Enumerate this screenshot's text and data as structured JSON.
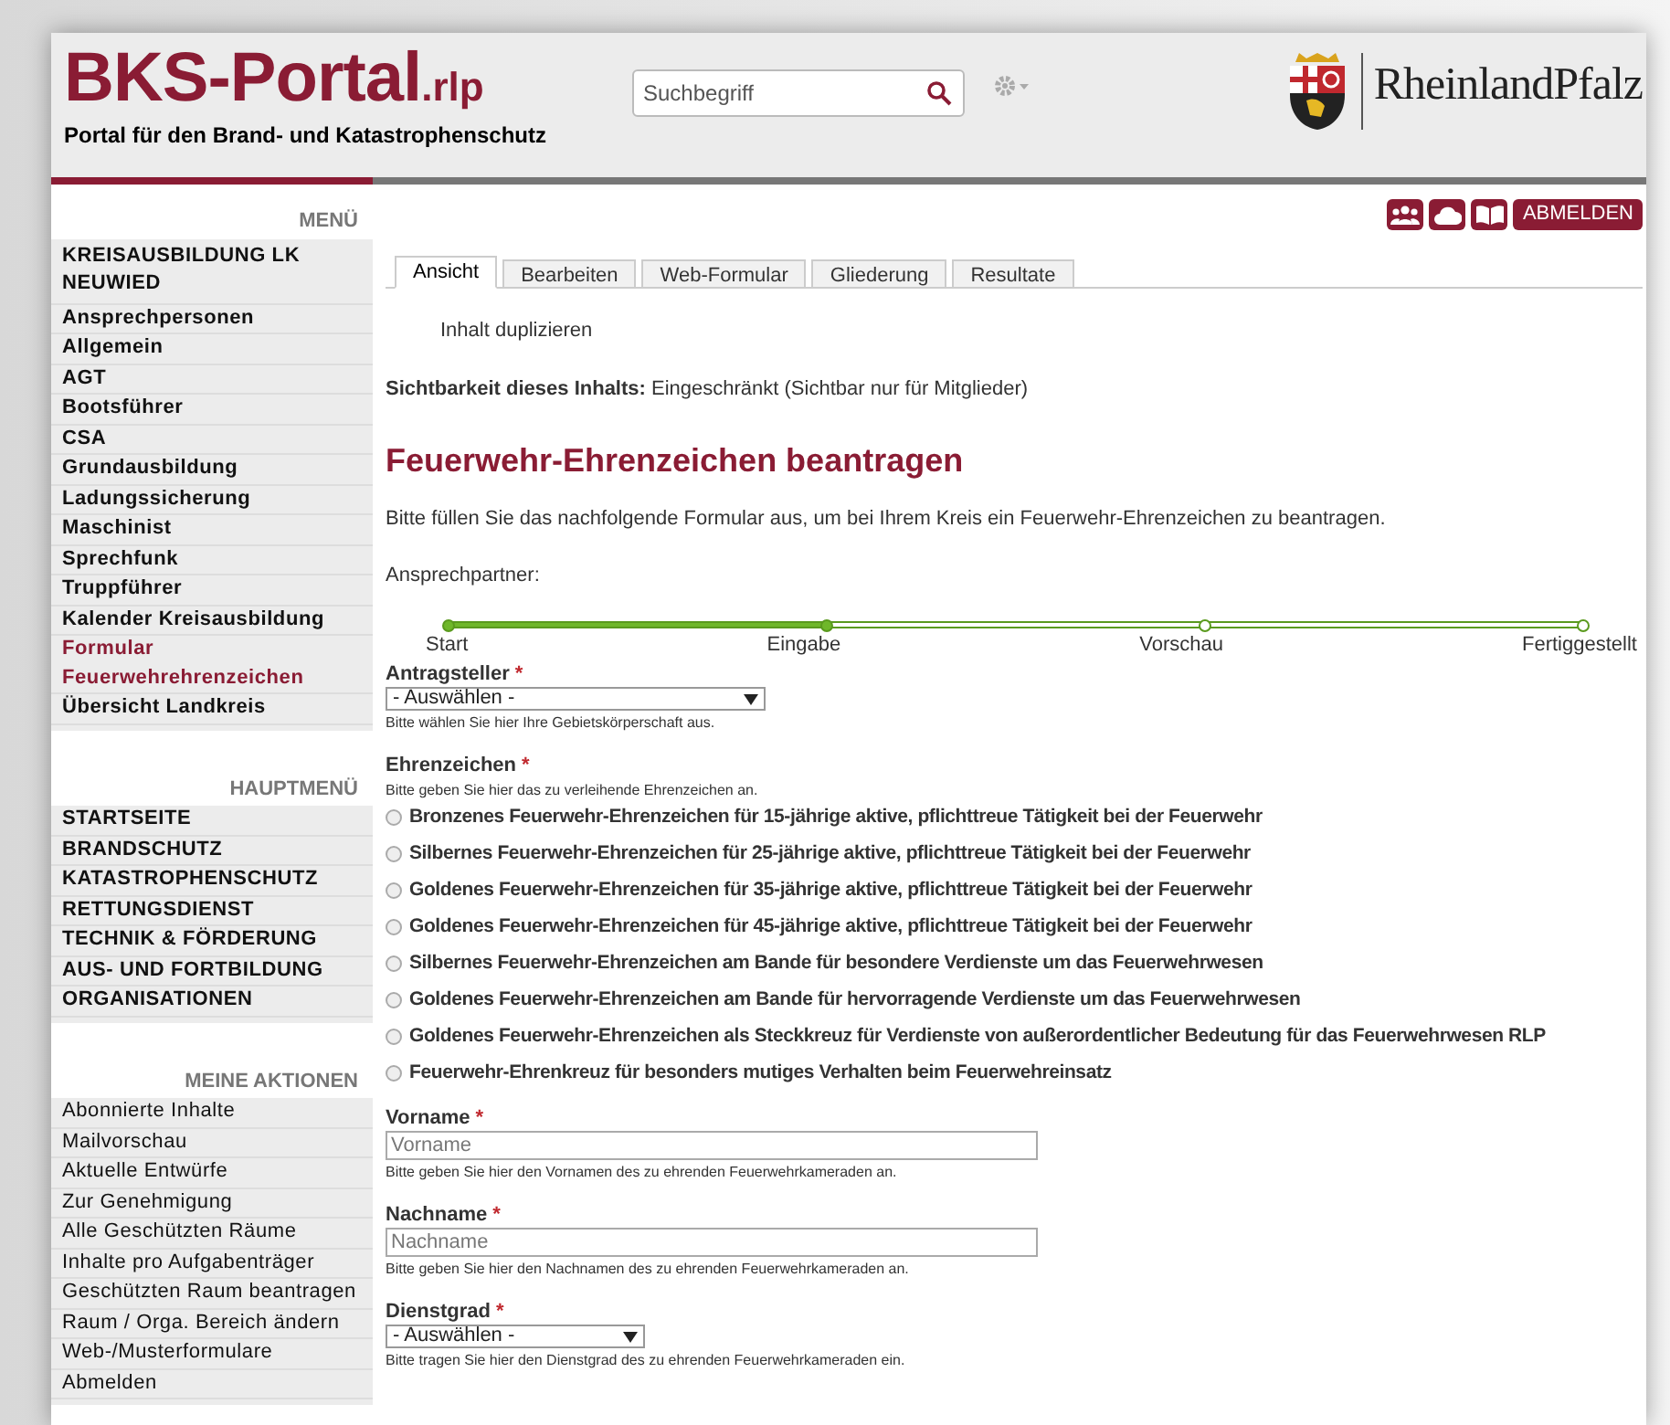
{
  "header": {
    "logo_main": "BKS-Portal",
    "logo_suffix": ".rlp",
    "subtitle": "Portal für den Brand- und Katastrophenschutz",
    "search": {
      "placeholder": "Suchbegriff"
    },
    "state_logo": "RheinlandPfalz"
  },
  "sidebar": [
    {
      "title": "MENÜ",
      "kind": "bold",
      "items": [
        {
          "label": "KREISAUSBILDUNG LK NEUWIED",
          "selected": false
        },
        {
          "label": "Ansprechpersonen",
          "selected": false
        },
        {
          "label": "Allgemein",
          "selected": false
        },
        {
          "label": "AGT",
          "selected": false
        },
        {
          "label": "Bootsführer",
          "selected": false
        },
        {
          "label": "CSA",
          "selected": false
        },
        {
          "label": "Grundausbildung",
          "selected": false
        },
        {
          "label": "Ladungssicherung",
          "selected": false
        },
        {
          "label": "Maschinist",
          "selected": false
        },
        {
          "label": "Sprechfunk",
          "selected": false
        },
        {
          "label": "Truppführer",
          "selected": false
        },
        {
          "label": "Kalender Kreisausbildung",
          "selected": false
        },
        {
          "label": "Formular Feuerwehrehrenzeichen",
          "selected": true
        },
        {
          "label": "Übersicht Landkreis",
          "selected": false
        }
      ]
    },
    {
      "title": "HAUPTMENÜ",
      "kind": "bold",
      "items": [
        {
          "label": "STARTSEITE",
          "selected": false
        },
        {
          "label": "BRANDSCHUTZ",
          "selected": false
        },
        {
          "label": "KATASTROPHENSCHUTZ",
          "selected": false
        },
        {
          "label": "RETTUNGSDIENST",
          "selected": false
        },
        {
          "label": "TECHNIK & FÖRDERUNG",
          "selected": false
        },
        {
          "label": "AUS- UND FORTBILDUNG",
          "selected": false
        },
        {
          "label": "ORGANISATIONEN",
          "selected": false
        }
      ]
    },
    {
      "title": "MEINE AKTIONEN",
      "kind": "plain",
      "items": [
        {
          "label": "Abonnierte Inhalte",
          "selected": false
        },
        {
          "label": "Mailvorschau",
          "selected": false
        },
        {
          "label": "Aktuelle Entwürfe",
          "selected": false
        },
        {
          "label": "Zur Genehmigung",
          "selected": false
        },
        {
          "label": "Alle Geschützten Räume",
          "selected": false
        },
        {
          "label": "Inhalte pro Aufgabenträger",
          "selected": false
        },
        {
          "label": "Geschützten Raum beantragen",
          "selected": false
        },
        {
          "label": "Raum / Orga. Bereich ändern",
          "selected": false
        },
        {
          "label": "Web-/Musterformulare",
          "selected": false
        },
        {
          "label": "Abmelden",
          "selected": false
        }
      ]
    }
  ],
  "logout_button": "ABMELDEN",
  "tabs": [
    {
      "label": "Ansicht",
      "selected": true
    },
    {
      "label": "Bearbeiten",
      "selected": false
    },
    {
      "label": "Web-Formular",
      "selected": false
    },
    {
      "label": "Gliederung",
      "selected": false
    },
    {
      "label": "Resultate",
      "selected": false
    }
  ],
  "duplicate_link": "Inhalt duplizieren",
  "visibility": "**Sichtbarkeit dieses Inhalts:** Eingeschränkt (Sichtbar nur für Mitglieder)",
  "title": "Feuerwehr-Ehrenzeichen beantragen",
  "intro": "Bitte füllen Sie das nachfolgende Formular aus, um bei Ihrem Kreis ein Feuerwehr-Ehrenzeichen zu beantragen.",
  "contact_label": "Ansprechpartner:",
  "progress": [
    {
      "label": "Start",
      "done": true
    },
    {
      "label": "Eingabe",
      "done": true
    },
    {
      "label": "Vorschau",
      "done": false
    },
    {
      "label": "Fertiggestellt",
      "done": false
    }
  ],
  "fields": [
    {
      "kind": "select",
      "label": "Antragsteller",
      "required_mark": "*",
      "value": "- Auswählen -",
      "help": "Bitte wählen Sie hier Ihre Gebietskörperschaft aus.",
      "wide": true
    },
    {
      "kind": "radio",
      "label": "Ehrenzeichen",
      "required_mark": "*",
      "help": "Bitte geben Sie hier das zu verleihende Ehrenzeichen an.",
      "options": [
        {
          "label": "Bronzenes Feuerwehr-Ehrenzeichen für 15-jährige aktive, pflichttreue Tätigkeit bei der Feuerwehr",
          "selected": false
        },
        {
          "label": "Silbernes Feuerwehr-Ehrenzeichen für 25-jährige aktive, pflichttreue Tätigkeit bei der Feuerwehr",
          "selected": false
        },
        {
          "label": "Goldenes Feuerwehr-Ehrenzeichen für 35-jährige aktive, pflichttreue Tätigkeit bei der Feuerwehr",
          "selected": false
        },
        {
          "label": "Goldenes Feuerwehr-Ehrenzeichen für 45-jährige aktive, pflichttreue Tätigkeit bei der Feuerwehr",
          "selected": false
        },
        {
          "label": "Silbernes Feuerwehr-Ehrenzeichen am Bande für besondere Verdienste um das Feuerwehrwesen",
          "selected": false
        },
        {
          "label": "Goldenes Feuerwehr-Ehrenzeichen am Bande für hervorragende Verdienste um das Feuerwehrwesen",
          "selected": false
        },
        {
          "label": "Goldenes Feuerwehr-Ehrenzeichen als Steckkreuz für Verdienste von außerordentlicher Bedeutung für das Feuerwehrwesen RLP",
          "selected": false
        },
        {
          "label": "Feuerwehr-Ehrenkreuz für besonders mutiges Verhalten beim Feuerwehreinsatz",
          "selected": false
        }
      ]
    },
    {
      "kind": "text",
      "label": "Vorname",
      "required_mark": "*",
      "placeholder": "Vorname",
      "help": "Bitte geben Sie hier den Vornamen des zu ehrenden Feuerwehrkameraden an."
    },
    {
      "kind": "text",
      "label": "Nachname",
      "required_mark": "*",
      "placeholder": "Nachname",
      "help": "Bitte geben Sie hier den Nachnamen des zu ehrenden Feuerwehrkameraden an."
    },
    {
      "kind": "select",
      "label": "Dienstgrad",
      "required_mark": "*",
      "value": "- Auswählen -",
      "help": "Bitte tragen Sie hier den Dienstgrad des zu ehrenden Feuerwehrkameraden ein.",
      "wide": false
    }
  ]
}
